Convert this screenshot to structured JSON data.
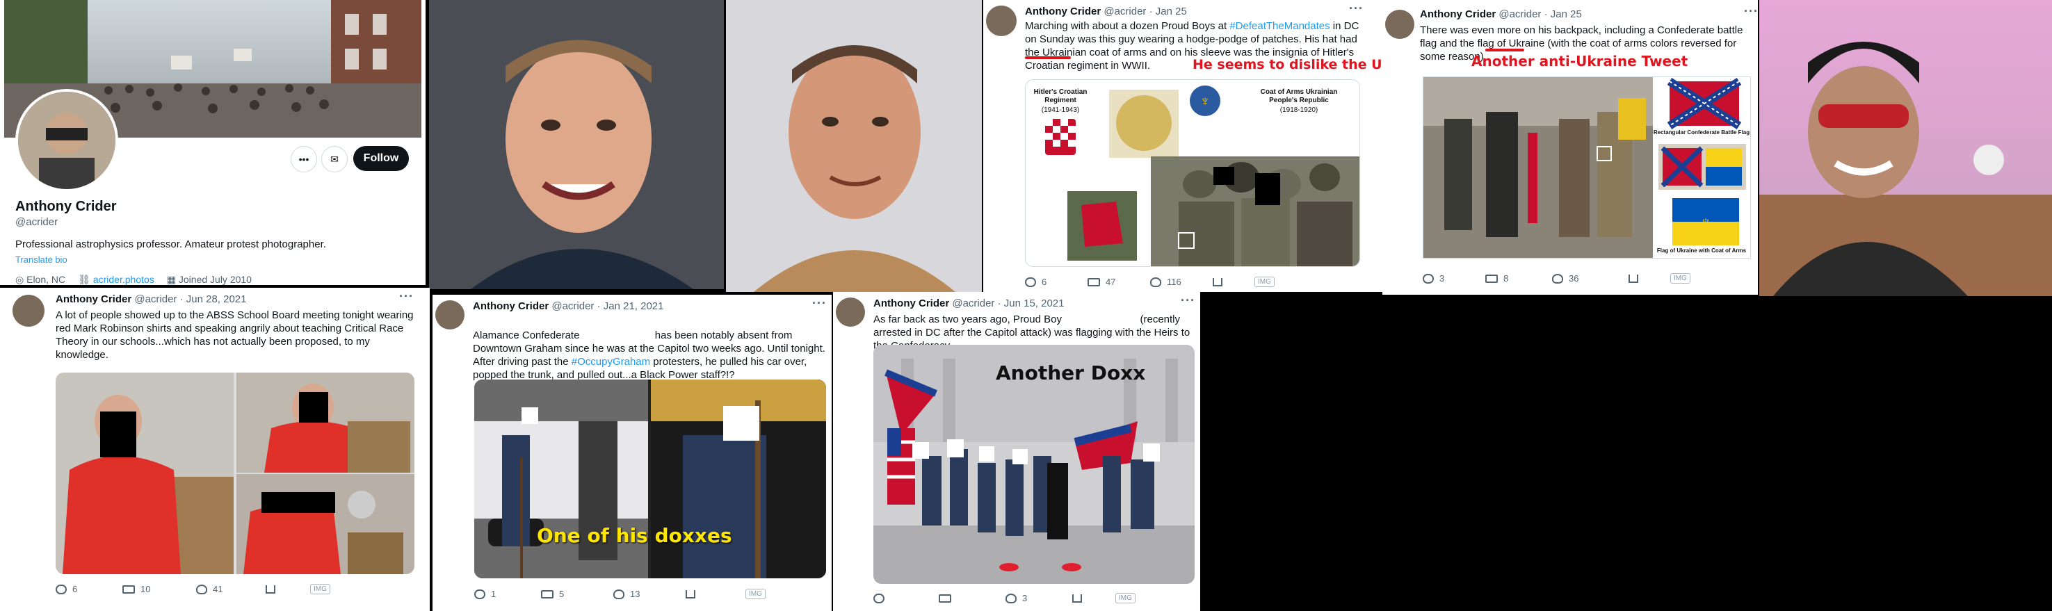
{
  "profile": {
    "name": "Anthony Crider",
    "handle": "@acrider",
    "bio": "Professional astrophysics professor. Amateur protest photographer.",
    "translate": "Translate bio",
    "location": "Elon, NC",
    "website": "acrider.photos",
    "joined": "Joined July 2010",
    "follow_label": "Follow",
    "more_icon": "more-icon",
    "mail_icon": "mail-icon"
  },
  "tweets": [
    {
      "name": "Anthony Crider",
      "meta": "@acrider · Jan 25",
      "text_parts": [
        "Marching with about a dozen Proud Boys at ",
        "#DefeatTheMandates",
        " in DC on Sunday was this guy wearing a hodge-podge of patches. His hat had the ",
        "Ukrainian",
        " coat of arms and on his sleeve was the insignia of Hitler's Croatian regiment in WWII."
      ],
      "annotation": "He seems to dislike the Ukraine",
      "image_labels": {
        "left_title": "Hitler's Croatian Regiment",
        "left_sub": "(1941-1943)",
        "right_title": "Coat of Arms Ukrainian People's Republic",
        "right_sub": "(1918-1920)"
      },
      "replies": "6",
      "retweets": "47",
      "likes": "116",
      "badge": "IMG"
    },
    {
      "name": "Anthony Crider",
      "meta": "@acrider · Jan 25",
      "text_parts": [
        "There was even more on his backpack, including a Confederate battle flag and the flag of ",
        "Ukraine",
        " (with the coat of arms colors reversed for some reason)."
      ],
      "annotation": "Another anti-Ukraine Tweet",
      "image_labels": {
        "flag1": "Rectangular Confederate Battle Flag",
        "flag2": "Flag of Ukraine with Coat of Arms"
      },
      "replies": "3",
      "retweets": "8",
      "likes": "36",
      "badge": "IMG"
    },
    {
      "name": "Anthony Crider",
      "meta": "@acrider · Jun 28, 2021",
      "text": "A lot of people showed up to the ABSS School Board meeting tonight wearing red Mark Robinson shirts and speaking angrily about teaching Critical Race Theory in our schools...which has not actually been proposed, to my knowledge.",
      "replies": "6",
      "retweets": "10",
      "likes": "41",
      "badge": "IMG"
    },
    {
      "name": "Anthony Crider",
      "meta": "@acrider · Jan 21, 2021",
      "text_parts": [
        "Alamance Confederate                          has been notably absent from Downtown Graham since he was at the Capitol two weeks ago. Until tonight. After driving past the ",
        "#OccupyGraham",
        " protesters, he pulled his car over, popped the trunk, and pulled out...a Black Power staff?!?"
      ],
      "annotation": "One of his doxxes",
      "replies": "1",
      "retweets": "5",
      "likes": "13",
      "badge": "IMG"
    },
    {
      "name": "Anthony Crider",
      "meta": "@acrider · Jun 15, 2021",
      "text": "As far back as two years ago, Proud Boy                           (recently arrested in DC after the Capitol attack) was flagging with the Heirs to the Confederacy.",
      "annotation": "Another Doxx",
      "replies": "",
      "retweets": "",
      "likes": "3",
      "badge": "IMG"
    }
  ],
  "colors": {
    "accent": "#1d9bf0",
    "annotation_red": "#e0141e",
    "annotation_yellow": "#ffe600"
  }
}
